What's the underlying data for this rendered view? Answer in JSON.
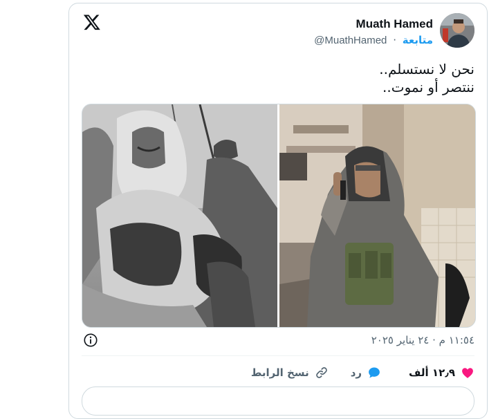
{
  "post": {
    "author_name": "Muath Hamed",
    "handle": "@MuathHamed",
    "separator": "·",
    "follow_label": "متابعة",
    "text_line1": "نحن لا نستسلم..",
    "text_line2": "ننتصر أو نموت..",
    "timestamp": "١١:٥٤ م · ٢٤ يناير ٢٠٢٥"
  },
  "actions": {
    "likes_count": "١٢٫٩ ألف",
    "reply_label": "رد",
    "copy_link_label": "نسخ الرابط"
  },
  "icons": {
    "platform": "x-logo-icon",
    "info": "info-icon",
    "like": "heart-icon",
    "reply": "speech-bubble-icon",
    "copy": "link-icon"
  },
  "colors": {
    "accent": "#1d9bf0",
    "like": "#f91880",
    "text": "#0f1419",
    "muted": "#536471",
    "border": "#cfd9de"
  }
}
